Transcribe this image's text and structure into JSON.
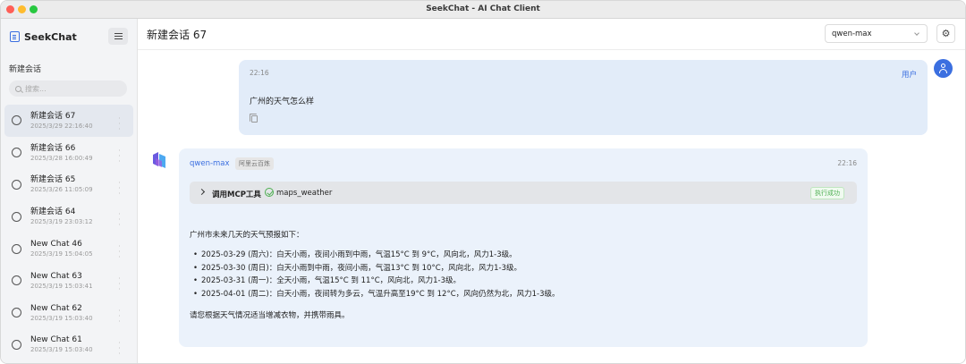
{
  "window": {
    "title": "SeekChat - AI Chat Client"
  },
  "sidebar": {
    "brand": "SeekChat",
    "new_chat_label": "新建会话",
    "search_placeholder": "搜索...",
    "conversations": [
      {
        "title": "新建会话 67",
        "date": "2025/3/29 22:16:40",
        "active": true
      },
      {
        "title": "新建会话 66",
        "date": "2025/3/28 16:00:49"
      },
      {
        "title": "新建会话 65",
        "date": "2025/3/26 11:05:09"
      },
      {
        "title": "新建会话 64",
        "date": "2025/3/19 23:03:12"
      },
      {
        "title": "New Chat 46",
        "date": "2025/3/19 15:04:05"
      },
      {
        "title": "New Chat 63",
        "date": "2025/3/19 15:03:41"
      },
      {
        "title": "New Chat 62",
        "date": "2025/3/19 15:03:40"
      },
      {
        "title": "New Chat 61",
        "date": "2025/3/19 15:03:40"
      }
    ]
  },
  "header": {
    "title": "新建会话 67",
    "model": "qwen-max"
  },
  "messages": {
    "user": {
      "time": "22:16",
      "name": "用户",
      "text": "广州的天气怎么样"
    },
    "assistant": {
      "model": "qwen-max",
      "provider": "阿里云百炼",
      "time": "22:16",
      "tool_call": {
        "label": "调用MCP工具",
        "tool": "maps_weather",
        "status": "执行成功"
      },
      "intro": "广州市未来几天的天气预报如下：",
      "forecast": [
        "2025-03-29 (周六)：白天小雨，夜间小雨到中雨，气温15°C 到 9°C，风向北，风力1-3级。",
        "2025-03-30 (周日)：白天小雨到中雨，夜间小雨，气温13°C 到 10°C，风向北，风力1-3级。",
        "2025-03-31 (周一)：全天小雨，气温15°C 到 11°C，风向北，风力1-3级。",
        "2025-04-01 (周二)：白天小雨，夜间转为多云，气温升高至19°C 到 12°C，风向仍然为北，风力1-3级。"
      ],
      "advice": "请您根据天气情况适当增减衣物，并携带雨具。"
    }
  },
  "colors": {
    "accent": "#3b6fe0",
    "user_bubble": "#e2ecf9",
    "bot_bubble": "#ebf2fb",
    "success": "#4caf50"
  }
}
